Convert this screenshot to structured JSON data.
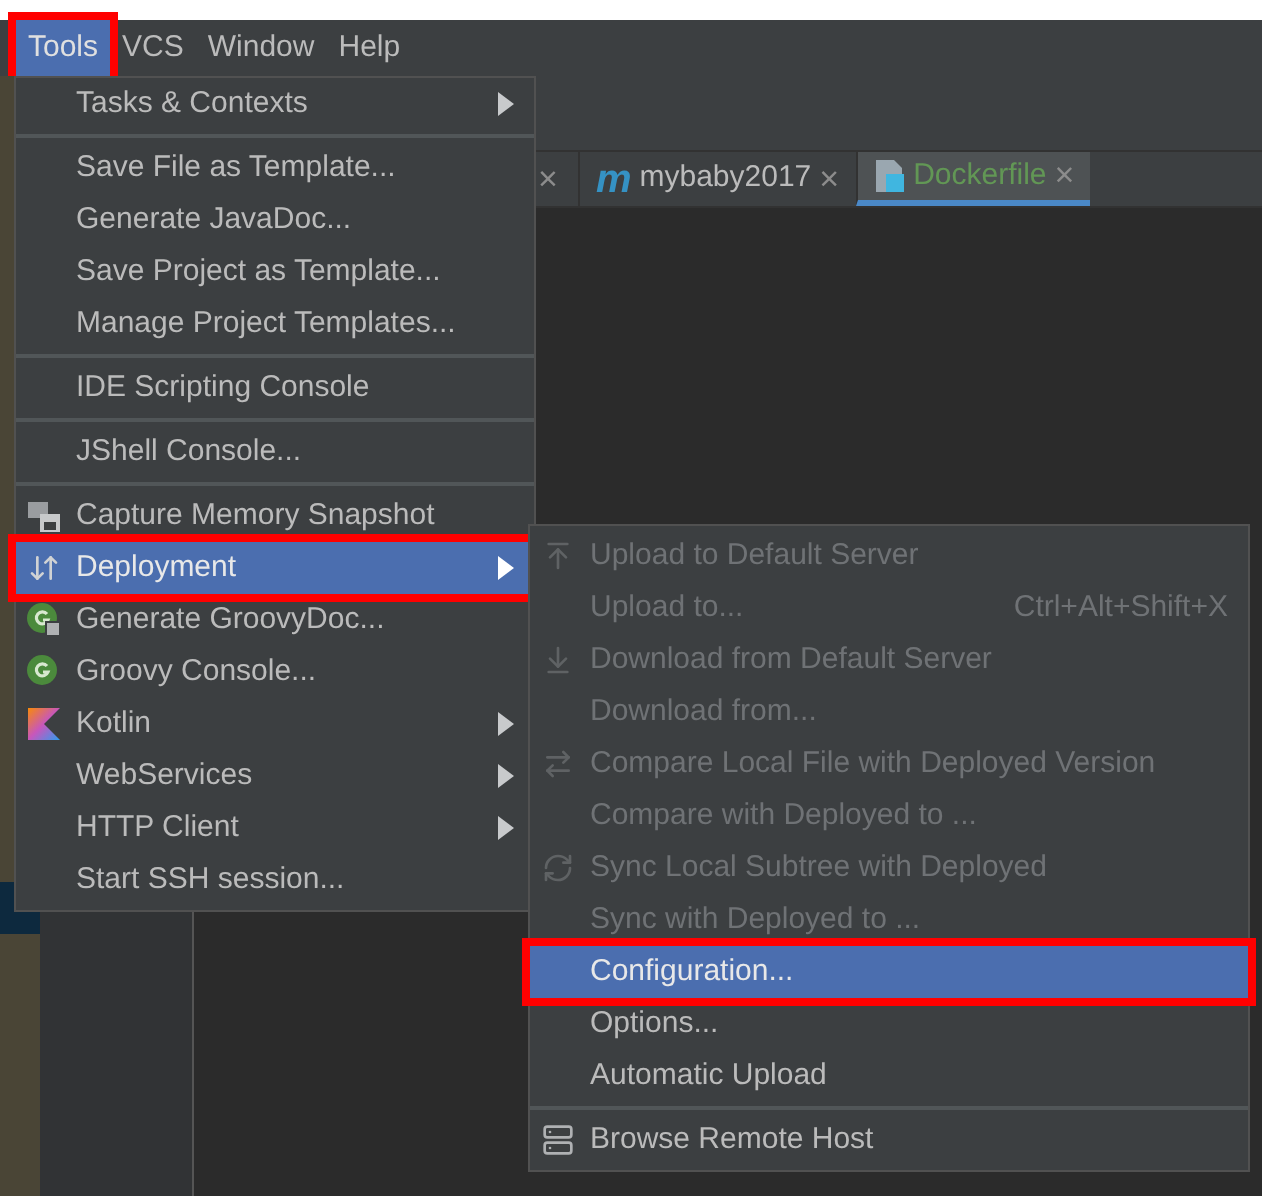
{
  "menubar": [
    {
      "label": "Tools",
      "selected": true,
      "annotated": true
    },
    {
      "label": "VCS",
      "selected": false,
      "annotated": false
    },
    {
      "label": "Window",
      "selected": false,
      "annotated": false
    },
    {
      "label": "Help",
      "selected": false,
      "annotated": false
    }
  ],
  "tabs": [
    {
      "label": "mybaby2017",
      "icon": "m",
      "kind": "letter",
      "close": "×",
      "selected": false
    },
    {
      "label": "Dockerfile",
      "kind": "docker",
      "close": "×",
      "selected": true
    }
  ],
  "partial_tab": {
    "close": "×"
  },
  "tools_menu": {
    "groups": [
      [
        {
          "label": "Tasks & Contexts",
          "submenu": true,
          "selected": false,
          "annotated": false
        }
      ],
      [
        {
          "label": "Save File as Template...",
          "submenu": false,
          "selected": false,
          "annotated": false
        },
        {
          "label": "Generate JavaDoc...",
          "submenu": false,
          "selected": false,
          "annotated": false
        },
        {
          "label": "Save Project as Template...",
          "submenu": false,
          "selected": false,
          "annotated": false
        },
        {
          "label": "Manage Project Templates...",
          "submenu": false,
          "selected": false,
          "annotated": false
        }
      ],
      [
        {
          "label": "IDE Scripting Console",
          "submenu": false,
          "selected": false,
          "annotated": false
        }
      ],
      [
        {
          "label": "JShell Console...",
          "submenu": false,
          "selected": false,
          "annotated": false
        }
      ],
      [
        {
          "label": "Capture Memory Snapshot",
          "kind": "capture",
          "submenu": false,
          "selected": false,
          "annotated": false
        },
        {
          "label": "Deployment",
          "kind": "deploy",
          "submenu": true,
          "selected": true,
          "annotated": true
        },
        {
          "label": "Generate GroovyDoc...",
          "kind": "groovydoc",
          "submenu": false,
          "selected": false,
          "annotated": false
        },
        {
          "label": "Groovy Console...",
          "kind": "groovy",
          "submenu": false,
          "selected": false,
          "annotated": false
        },
        {
          "label": "Kotlin",
          "kind": "kotlin",
          "submenu": true,
          "selected": false,
          "annotated": false
        },
        {
          "label": "WebServices",
          "submenu": true,
          "selected": false,
          "annotated": false
        },
        {
          "label": "HTTP Client",
          "submenu": true,
          "selected": false,
          "annotated": false
        },
        {
          "label": "Start SSH session...",
          "submenu": false,
          "selected": false,
          "annotated": false
        }
      ]
    ]
  },
  "deployment_submenu": {
    "groups": [
      [
        {
          "label": "Upload to Default Server",
          "kind": "upload",
          "disabled": true,
          "selected": false,
          "annotated": false
        },
        {
          "label": "Upload to...",
          "shortcut": "Ctrl+Alt+Shift+X",
          "disabled": true,
          "selected": false,
          "annotated": false
        },
        {
          "label": "Download from Default Server",
          "kind": "download",
          "disabled": true,
          "selected": false,
          "annotated": false
        },
        {
          "label": "Download from...",
          "disabled": true,
          "selected": false,
          "annotated": false
        },
        {
          "label": "Compare Local File with Deployed Version",
          "kind": "compare",
          "disabled": true,
          "selected": false,
          "annotated": false
        },
        {
          "label": "Compare with Deployed to ...",
          "disabled": true,
          "selected": false,
          "annotated": false
        },
        {
          "label": "Sync Local Subtree with Deployed",
          "kind": "sync",
          "disabled": true,
          "selected": false,
          "annotated": false
        },
        {
          "label": "Sync with Deployed to ...",
          "disabled": true,
          "selected": false,
          "annotated": false
        },
        {
          "label": "Configuration...",
          "disabled": false,
          "selected": true,
          "annotated": true
        },
        {
          "label": "Options...",
          "disabled": false,
          "selected": false,
          "annotated": false
        },
        {
          "label": "Automatic Upload",
          "disabled": false,
          "selected": false,
          "annotated": false
        }
      ],
      [
        {
          "label": "Browse Remote Host",
          "kind": "server",
          "disabled": false,
          "selected": false,
          "annotated": false
        }
      ]
    ]
  }
}
